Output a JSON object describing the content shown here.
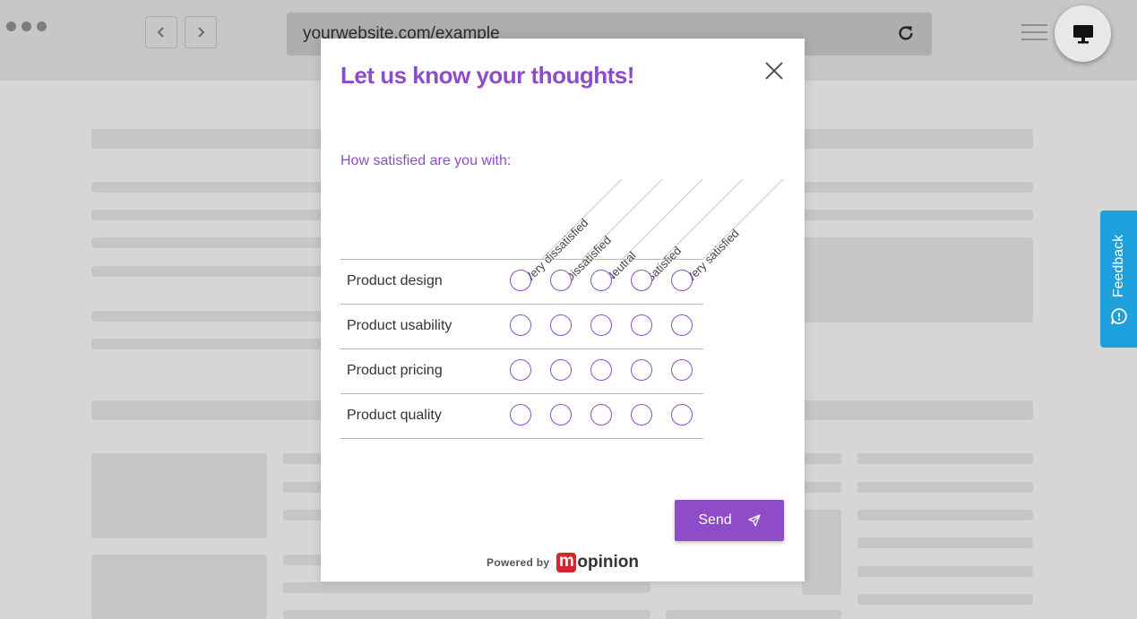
{
  "browser": {
    "url": "yourwebsite.com/example",
    "back_icon": "chevron-left-icon",
    "forward_icon": "chevron-right-icon",
    "reload_icon": "reload-icon",
    "menu_icon": "hamburger-icon",
    "device_icon": "desktop-icon"
  },
  "feedback_tab": {
    "label": "Feedback",
    "icon": "speech-bubble-icon"
  },
  "modal": {
    "title": "Let us know your thoughts!",
    "close_icon": "close-icon",
    "question": "How satisfied are you with:",
    "columns": [
      "Very dissatisfied",
      "Dissatisfied",
      "Neutral",
      "Satisfied",
      "Very satisfied"
    ],
    "rows": [
      "Product design",
      "Product usability",
      "Product pricing",
      "Product quality"
    ],
    "send_label": "Send",
    "send_icon": "paper-plane-icon",
    "powered_by": "Powered by",
    "brand_m": "m",
    "brand_rest": "opinion"
  },
  "colors": {
    "accent": "#8e4cc9",
    "feedback_tab": "#1ea0dc",
    "brand_red": "#d22630"
  }
}
